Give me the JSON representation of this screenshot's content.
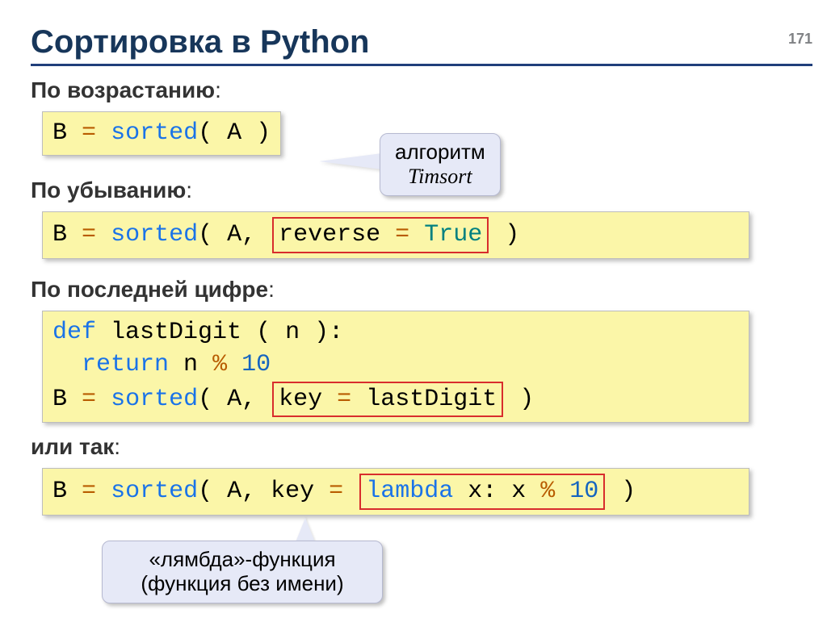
{
  "page_number": "171",
  "title": "Сортировка в Python",
  "sections": {
    "asc": {
      "label_bold": "По возрастанию",
      "label_tail": ":"
    },
    "desc": {
      "label_bold": "По убыванию",
      "label_tail": ":"
    },
    "last": {
      "label_bold": "По последней цифре",
      "label_tail": ":"
    },
    "or": {
      "label_bold": "или так",
      "label_tail": ":"
    }
  },
  "code": {
    "asc": {
      "b": "B",
      "eq": "=",
      "sorted": "sorted",
      "open": "(",
      "a_sp": " A ",
      "close": ")"
    },
    "desc": {
      "b": "B",
      "eq": "=",
      "sorted": "sorted",
      "open": "(",
      "a": " A, ",
      "rev_text": "reverse",
      "rev_eq": "=",
      "rev_val": "True",
      "sp_close": " )"
    },
    "last": {
      "def": "def",
      "fn": " lastDigit ",
      "args": "( n ):",
      "ret": "return",
      "expr_n": " n",
      "pct": "%",
      "ten": "10",
      "b": "B",
      "eq": "=",
      "sorted": "sorted",
      "open": "(",
      "a": " A, ",
      "key": "key",
      "keq": "=",
      "kval": "lastDigit",
      "sp_close": " )"
    },
    "lambda": {
      "b": "B",
      "eq": "=",
      "sorted": "sorted",
      "open": "(",
      "a": " A, key",
      "keq": "=",
      "lam": "lambda",
      "lx": " x: x",
      "pct": "%",
      "ten": "10",
      "sp_close": " )"
    }
  },
  "callouts": {
    "timsort_line1": "алгоритм",
    "timsort_line2": "Timsort",
    "lambda_line1": "«лямбда»-функция",
    "lambda_line2": "(функция без имени)"
  }
}
